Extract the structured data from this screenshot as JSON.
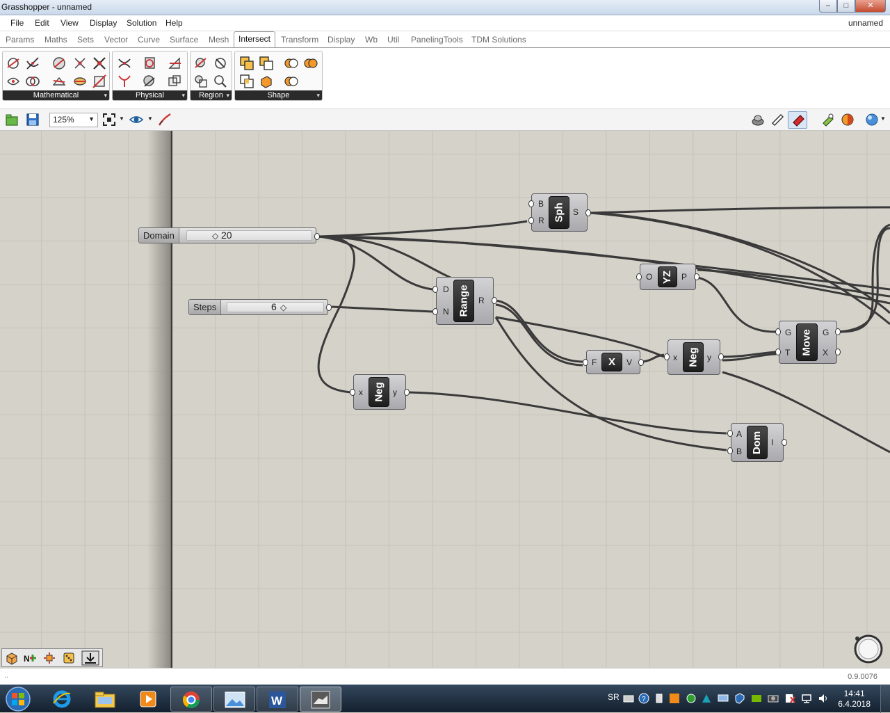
{
  "window": {
    "title": "Grasshopper - unnamed",
    "controls": [
      "–",
      "□",
      "✕"
    ]
  },
  "menu": {
    "items": [
      "File",
      "Edit",
      "View",
      "Display",
      "Solution",
      "Help"
    ],
    "document_name": "unnamed"
  },
  "tabs": [
    "Params",
    "Maths",
    "Sets",
    "Vector",
    "Curve",
    "Surface",
    "Mesh",
    "Intersect",
    "Transform",
    "Display",
    "Wb",
    "Util",
    "PanelingTools",
    "TDM Solutions"
  ],
  "active_tab": "Intersect",
  "ribbon": {
    "groups": [
      "Mathematical",
      "Physical",
      "Region",
      "Shape"
    ],
    "expander": "▾"
  },
  "toolbar": {
    "zoom": "125%"
  },
  "canvas": {
    "sliders": {
      "domain": {
        "name": "Domain",
        "value": "20"
      },
      "steps": {
        "name": "Steps",
        "value": "6"
      }
    },
    "components": {
      "sph": {
        "label": "Sph",
        "inputs": [
          "B",
          "R"
        ],
        "outputs": [
          "S"
        ]
      },
      "range": {
        "label": "Range",
        "inputs": [
          "D",
          "N"
        ],
        "outputs": [
          "R"
        ]
      },
      "yz": {
        "label": "YZ",
        "inputs": [
          "O"
        ],
        "outputs": [
          "P"
        ]
      },
      "move": {
        "label": "Move",
        "inputs": [
          "G",
          "T"
        ],
        "outputs": [
          "G",
          "X"
        ]
      },
      "xvec": {
        "label": "X",
        "inputs": [
          "F"
        ],
        "outputs": [
          "V"
        ]
      },
      "neg1": {
        "label": "Neg",
        "inputs": [
          "x"
        ],
        "outputs": [
          "y"
        ]
      },
      "neg2": {
        "label": "Neg",
        "inputs": [
          "x"
        ],
        "outputs": [
          "y"
        ]
      },
      "dom": {
        "label": "Dom",
        "inputs": [
          "A",
          "B"
        ],
        "outputs": [
          "I"
        ]
      }
    }
  },
  "status": {
    "left": "..",
    "version": "0.9.0076"
  },
  "taskbar": {
    "language": "SR",
    "time": "14:41",
    "date": "6.4.2018"
  }
}
